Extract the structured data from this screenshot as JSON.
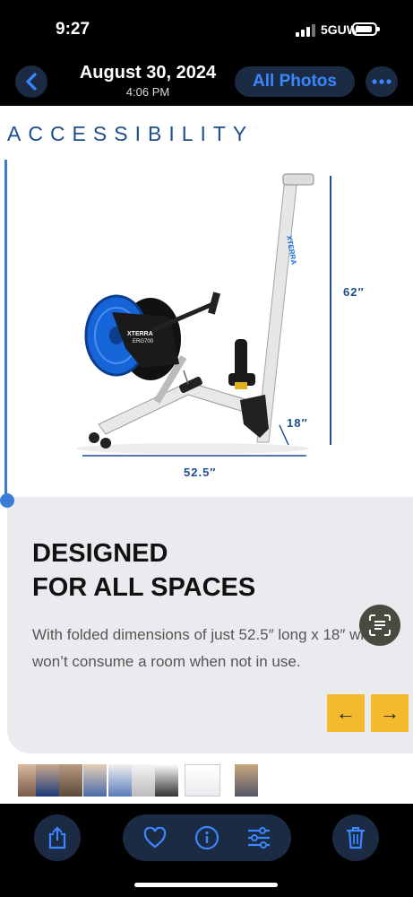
{
  "status": {
    "time": "9:27",
    "network": "5GUW"
  },
  "nav": {
    "title": "August 30, 2024",
    "subtitle": "4:06 PM",
    "all_photos": "All Photos",
    "back_icon": "chevron-left-icon",
    "more_icon": "ellipsis-icon"
  },
  "photo": {
    "heading": "ACCESSIBILITY",
    "brand": "XTERRA",
    "model": "ERG700",
    "dim_height": "62″",
    "dim_width": "18″",
    "dim_length": "52.5″",
    "panel_title_line1": "DESIGNED",
    "panel_title_line2": "FOR ALL SPACES",
    "panel_text": "With folded dimensions of just 52.5″ long x 18″ wide it won’t consume a room when not in use.",
    "prev_arrow": "←",
    "next_arrow": "→"
  },
  "toolbar": {
    "share_icon": "share-icon",
    "favorite_icon": "heart-icon",
    "info_icon": "info-icon",
    "adjust_icon": "sliders-icon",
    "delete_icon": "trash-icon"
  },
  "colors": {
    "accent": "#3a86ff",
    "button_bg": "#1c2b44",
    "brand_blue": "#1f4e8c",
    "arrow_bg": "#f5b92e",
    "wheel_blue": "#1565d8"
  }
}
